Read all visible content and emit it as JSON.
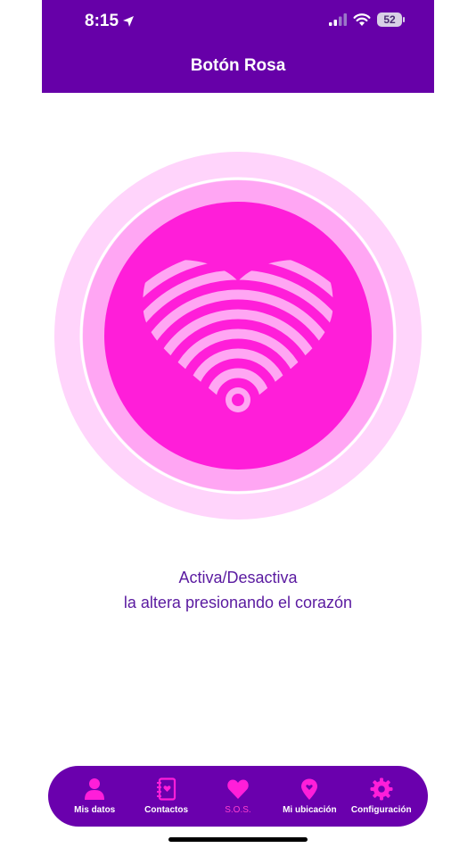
{
  "status_bar": {
    "time": "8:15",
    "battery": "52"
  },
  "header": {
    "title": "Botón Rosa"
  },
  "instructions": {
    "line1": "Activa/Desactiva",
    "line2": "la altera presionando el corazón"
  },
  "tabs": [
    {
      "label": "Mis datos",
      "icon": "person-icon",
      "active": false
    },
    {
      "label": "Contactos",
      "icon": "contacts-book-icon",
      "active": false
    },
    {
      "label": "S.O.S.",
      "icon": "heart-icon",
      "active": true
    },
    {
      "label": "Mi ubicación",
      "icon": "location-pin-icon",
      "active": false
    },
    {
      "label": "Configuración",
      "icon": "gear-icon",
      "active": false
    }
  ],
  "colors": {
    "header": "#6600a8",
    "accent": "#ff1ed9",
    "tabbar": "#6a00ad",
    "text": "#5a1aa0"
  }
}
